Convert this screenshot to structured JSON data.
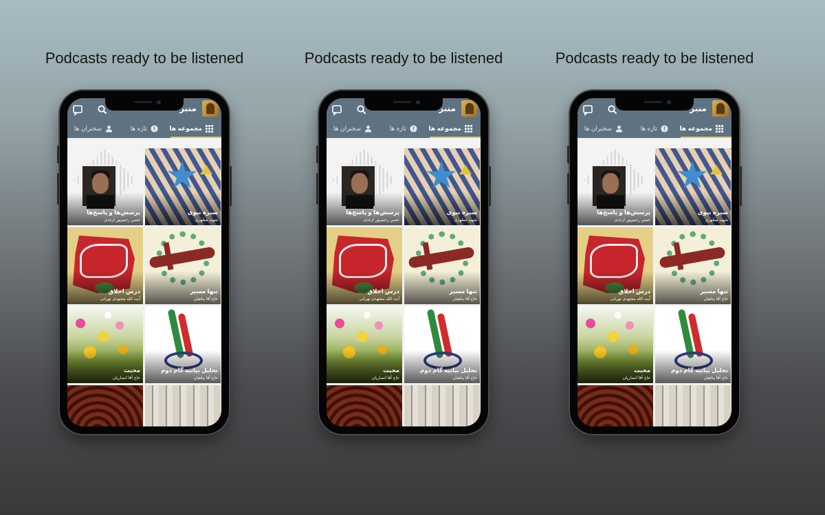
{
  "caption": "Podcasts ready to be listened",
  "app": {
    "title": "منبر",
    "tabs": {
      "collections": "مجموعه ها",
      "new": "تازه ها",
      "speakers": "سخنران ها"
    }
  },
  "tiles": [
    {
      "title": "سیره نبوی",
      "speaker": "شهید مطهری"
    },
    {
      "title": "پرسش‌ها و پاسخ‌ها",
      "speaker": "حسن رحیم‌پور ازغدی"
    },
    {
      "title": "تنها مسیر",
      "speaker": "حاج آقا پناهیان"
    },
    {
      "title": "درس اخلاق",
      "speaker": "آیت الله مجتهدی تهرانی"
    },
    {
      "title": "تحلیل بیانیه گام دوم",
      "speaker": "حاج آقا پناهیان"
    },
    {
      "title": "محبت",
      "speaker": "حاج آقا انصاریان"
    },
    {
      "title": "",
      "speaker": ""
    },
    {
      "title": "",
      "speaker": ""
    }
  ],
  "icons": {
    "chat": "chat-icon",
    "search": "search-icon",
    "grid": "grid-icon",
    "new": "info-icon",
    "speakers": "person-icon",
    "logo": "microphone-logo"
  },
  "colors": {
    "appbar": "#5f7282",
    "tab_indicator": "#f2d02b"
  }
}
